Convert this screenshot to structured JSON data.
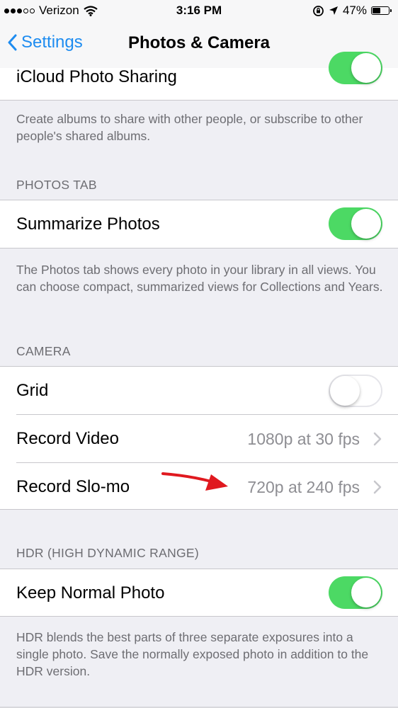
{
  "status_bar": {
    "carrier": "Verizon",
    "time": "3:16 PM",
    "battery_percent": "47%",
    "battery_level": 0.47
  },
  "nav": {
    "back_label": "Settings",
    "title": "Photos & Camera"
  },
  "icloud": {
    "label": "iCloud Photo Sharing",
    "enabled": true,
    "footer": "Create albums to share with other people, or subscribe to other people's shared albums."
  },
  "photos_tab": {
    "header": "PHOTOS TAB",
    "summarize_label": "Summarize Photos",
    "summarize_enabled": true,
    "footer": "The Photos tab shows every photo in your library in all views. You can choose compact, summarized views for Collections and Years."
  },
  "camera": {
    "header": "CAMERA",
    "grid_label": "Grid",
    "grid_enabled": false,
    "record_video_label": "Record Video",
    "record_video_value": "1080p at 30 fps",
    "record_slomo_label": "Record Slo-mo",
    "record_slomo_value": "720p at 240 fps"
  },
  "hdr": {
    "header": "HDR (HIGH DYNAMIC RANGE)",
    "keep_normal_label": "Keep Normal Photo",
    "keep_normal_enabled": true,
    "footer": "HDR blends the best parts of three separate exposures into a single photo. Save the normally exposed photo in addition to the HDR version."
  },
  "colors": {
    "accent": "#1e8cf0",
    "toggle_on": "#4cd964",
    "annotation_arrow": "#e0191f"
  }
}
